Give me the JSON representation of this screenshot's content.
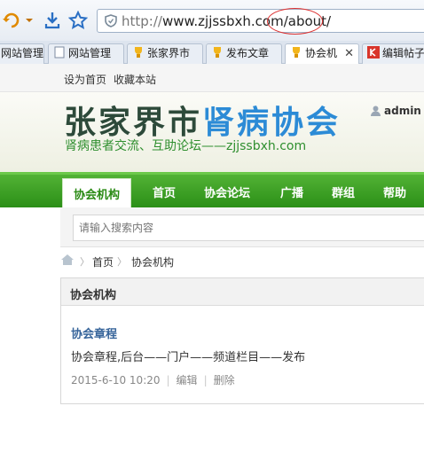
{
  "browser": {
    "url_protocol": "http://",
    "url_host": "www.zjjssbxh.com/",
    "url_path": "about/"
  },
  "tabs": [
    {
      "label": "网站管理"
    },
    {
      "label": "网站管理"
    },
    {
      "label": "张家界市"
    },
    {
      "label": "发布文章"
    },
    {
      "label": "协会机"
    },
    {
      "label": "编辑帖子"
    }
  ],
  "topnav": {
    "set_home": "设为首页",
    "bookmark": "收藏本站"
  },
  "header": {
    "logo_dark": "张家界市",
    "logo_blue": "肾病协会",
    "tagline": "肾病患者交流、互助论坛——zjjssbxh.com",
    "username": "admin"
  },
  "nav": {
    "items": [
      "协会机构",
      "首页",
      "协会论坛",
      "广播",
      "群组",
      "帮助"
    ]
  },
  "search": {
    "placeholder": "请输入搜索内容"
  },
  "breadcrumb": {
    "home": "首页",
    "current": "协会机构"
  },
  "panel": {
    "title": "协会机构",
    "article": {
      "title": "协会章程",
      "summary": "协会章程,后台——门户——频道栏目——发布",
      "date": "2015-6-10 10:20",
      "edit": "编辑",
      "delete": "删除"
    }
  },
  "colors": {
    "nav_green": "#3aa022",
    "logo_blue": "#2c8bd6",
    "link_blue": "#36649a",
    "annotation_red": "#dd3333"
  }
}
